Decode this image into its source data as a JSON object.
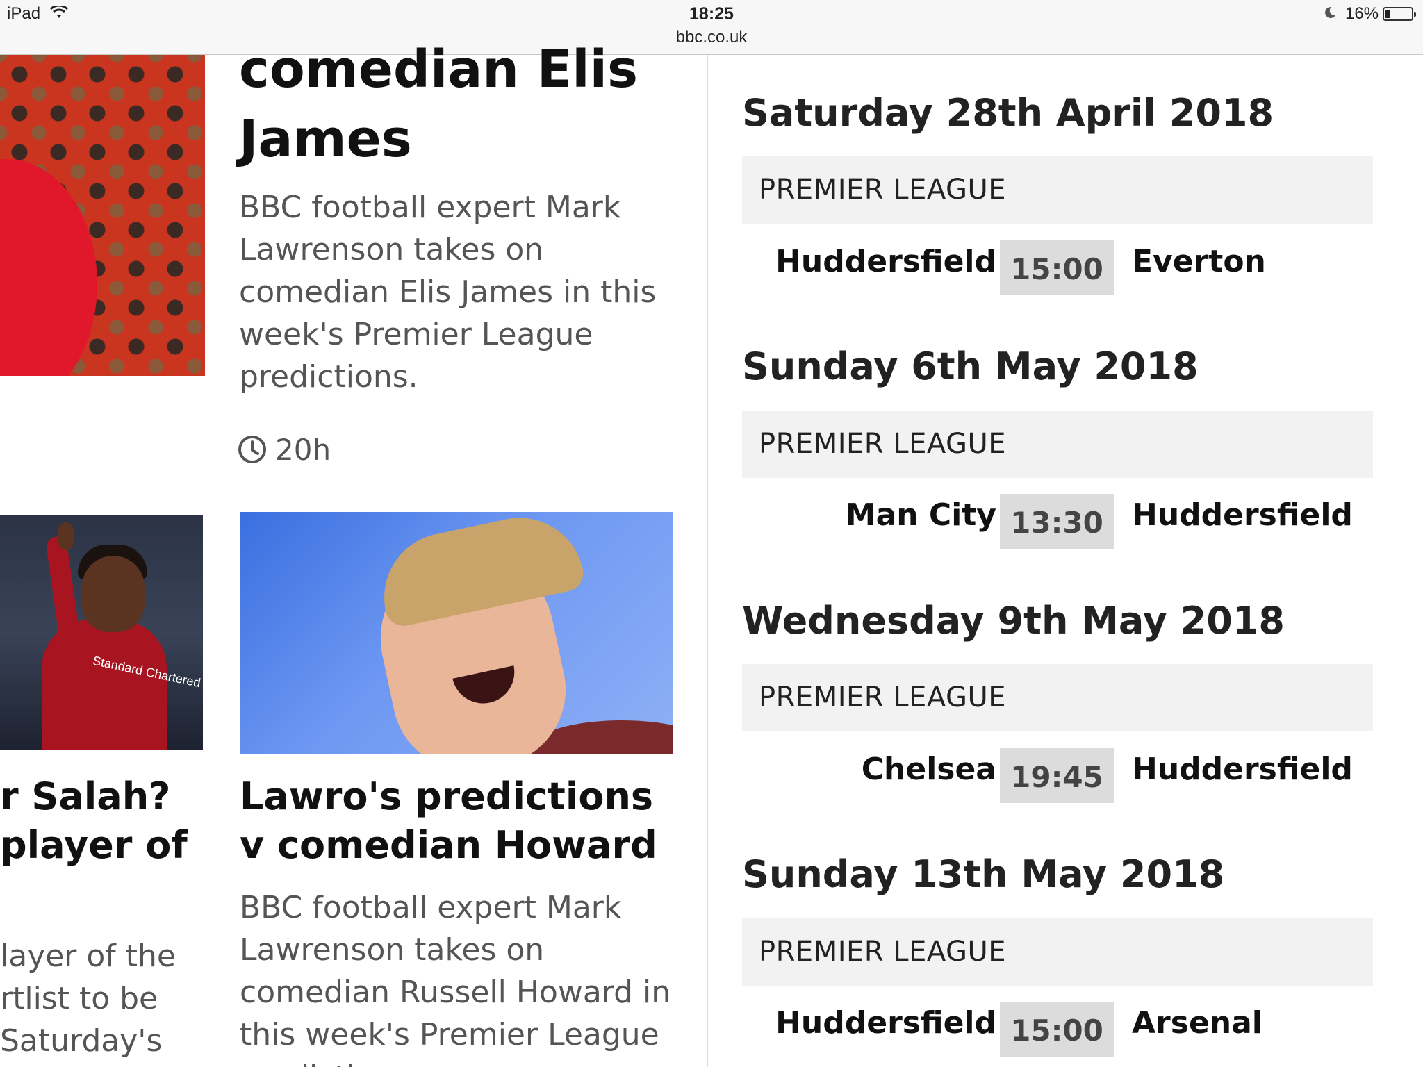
{
  "status_bar": {
    "device": "iPad",
    "time": "18:25",
    "url": "bbc.co.uk",
    "battery": "16%",
    "battery_level": 0.16
  },
  "left_column": {
    "article_top": {
      "headline": "comedian Elis James",
      "summary": "BBC football expert Mark Lawrenson takes on comedian Elis James in this week's Premier League predictions.",
      "age": "20h"
    },
    "article_salah": {
      "headline_lines": [
        "r Salah?",
        " player of"
      ],
      "summary_lines": [
        "layer of the",
        "rtlist to be",
        "Saturday's"
      ],
      "image_text": "Standard Chartered"
    },
    "article_russell": {
      "headline": "Lawro's predictions v comedian Howard",
      "summary": "BBC football expert Mark Lawrenson takes on comedian Russell Howard in this week's Premier League predictions."
    }
  },
  "fixtures": [
    {
      "date": "Saturday 28th April 2018",
      "competition": "PREMIER LEAGUE",
      "home": "Huddersfield",
      "kickoff": "15:00",
      "away": "Everton"
    },
    {
      "date": "Sunday 6th May 2018",
      "competition": "PREMIER LEAGUE",
      "home": "Man City",
      "kickoff": "13:30",
      "away": "Huddersfield"
    },
    {
      "date": "Wednesday 9th May 2018",
      "competition": "PREMIER LEAGUE",
      "home": "Chelsea",
      "kickoff": "19:45",
      "away": "Huddersfield"
    },
    {
      "date": "Sunday 13th May 2018",
      "competition": "PREMIER LEAGUE",
      "home": "Huddersfield",
      "kickoff": "15:00",
      "away": "Arsenal"
    }
  ]
}
